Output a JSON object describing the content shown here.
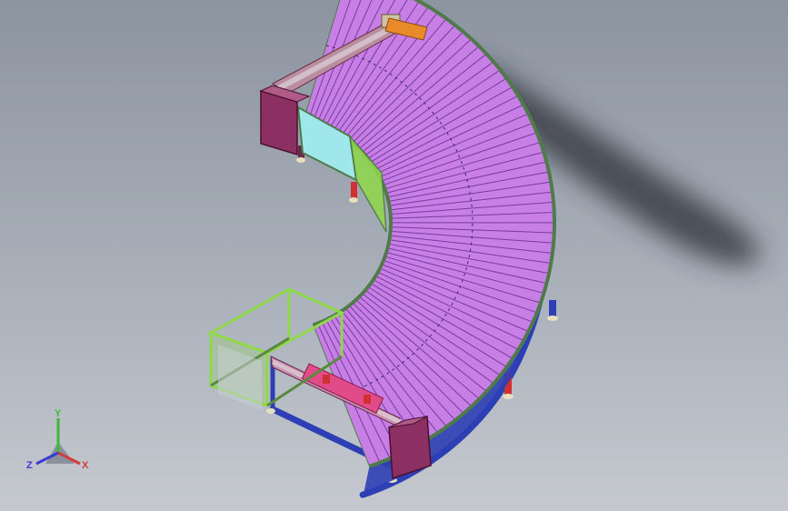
{
  "scene": {
    "background_top": "#8c94a0",
    "background_bottom": "#c5c9cf",
    "roller_color": "#c77fe6",
    "roller_line_color": "#7a3aa0",
    "frame_rail_color": "#4f7a4a",
    "support_blue": "#2e3fb5",
    "end_plate_color": "#8c2f63",
    "guard_color": "#8fd84a",
    "accent_orange": "#e98a2a",
    "accent_red": "#d03030",
    "glass_color": "#9fe7ea",
    "roller_count": 64
  },
  "triad": {
    "y_label": "Y",
    "x_label": "X",
    "z_label": "Z",
    "y_color": "#3bb83b",
    "x_color": "#d43a3a",
    "z_color": "#3a3ad4"
  }
}
